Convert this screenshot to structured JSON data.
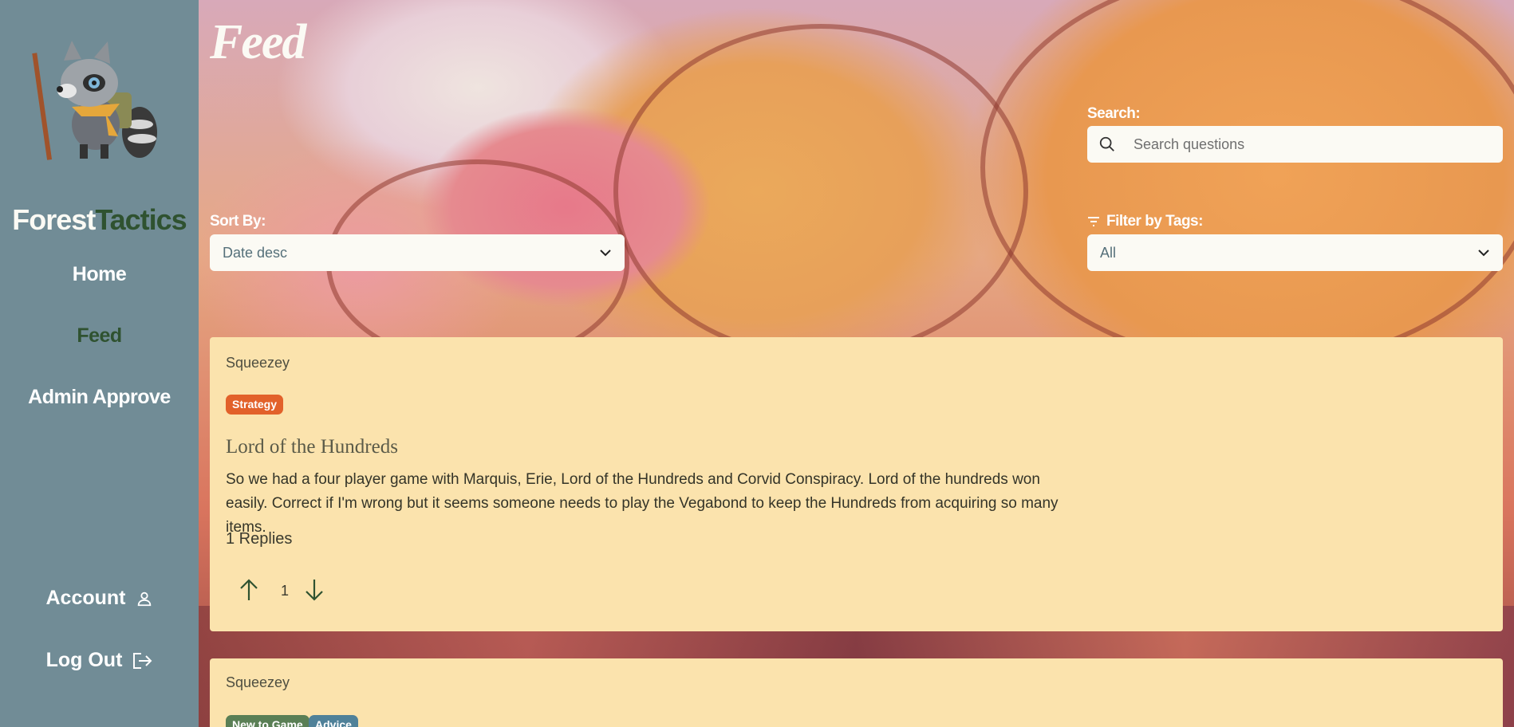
{
  "sidebar": {
    "brand_part1": "Forest",
    "brand_part2": "Tactics",
    "nav": {
      "home": "Home",
      "feed": "Feed",
      "admin": "Admin Approve"
    },
    "account_label": "Account",
    "logout_label": "Log Out",
    "icons": {
      "account": "user-icon",
      "logout": "logout-icon"
    }
  },
  "main": {
    "title": "Feed",
    "search": {
      "label": "Search:",
      "placeholder": "Search questions",
      "icon": "search-icon"
    },
    "sort": {
      "label": "Sort By:",
      "value": "Date desc"
    },
    "filter": {
      "label": "Filter by Tags:",
      "value": "All",
      "icon": "filter-icon"
    }
  },
  "posts": [
    {
      "author": "Squeezey",
      "tags": [
        {
          "label": "Strategy",
          "color": "#e2612a"
        }
      ],
      "title": "Lord of the Hundreds",
      "body": "So we had a four player game with Marquis, Erie, Lord of the Hundreds and Corvid Conspiracy. Lord of the hundreds won easily. Correct if I'm wrong but it seems someone needs to play the Vegabond to keep the Hundreds from acquiring so many items.",
      "replies": "1 Replies",
      "votes": "1"
    },
    {
      "author": "Squeezey",
      "tags": [
        {
          "label": "New to Game",
          "color": "#5a7f55"
        },
        {
          "label": "Advice",
          "color": "#4f8199"
        }
      ]
    }
  ],
  "colors": {
    "sidebar": "#718c96",
    "accent_green": "#2f5230",
    "card": "#fbe3ad"
  }
}
